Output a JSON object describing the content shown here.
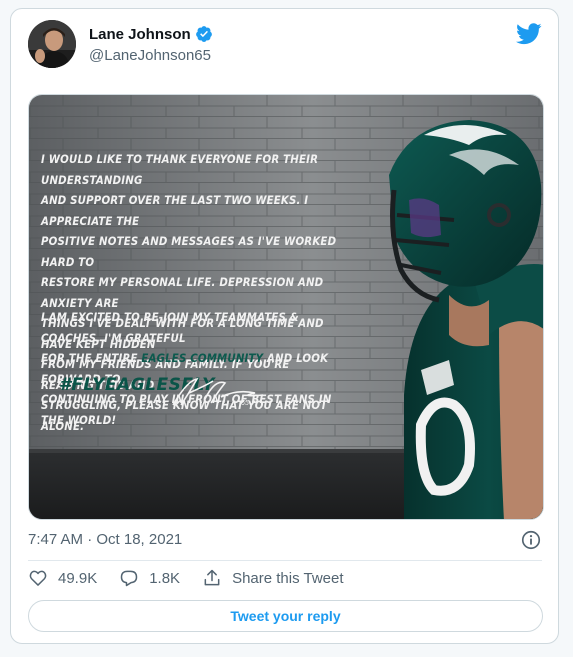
{
  "author": {
    "name": "Lane Johnson",
    "handle": "@LaneJohnson65",
    "verified": true
  },
  "media": {
    "message_part1": "I would like to thank everyone for their understanding\nand support over the last two weeks. I appreciate the\npositive notes and messages as I've worked hard to\nrestore my personal life. Depression and anxiety are\nthings I've dealt with for a long time and have kept hidden\nfrom my friends and family. If you're reading this and\nstruggling, please know that you are not alone.",
    "message_part2a": "I am excited to re-join my teammates & coaches. I'm grateful\nfor the entire ",
    "message_highlight": "Eagles community",
    "message_part2b": " and look forward to\ncontinuing to play in front of best fans in the world!",
    "hashtag": "#FLYEAGLESFLY"
  },
  "timestamp": "7:47 AM · Oct 18, 2021",
  "actions": {
    "likes": "49.9K",
    "replies": "1.8K",
    "share_label": "Share this Tweet"
  },
  "reply_button": "Tweet your reply",
  "colors": {
    "accent": "#1d9bf0",
    "muted_text": "#536471",
    "eagles_green": "#0a5448"
  },
  "icons": [
    "verified-badge-icon",
    "twitter-bird-icon",
    "info-icon",
    "heart-icon",
    "reply-bubble-icon",
    "share-icon"
  ]
}
